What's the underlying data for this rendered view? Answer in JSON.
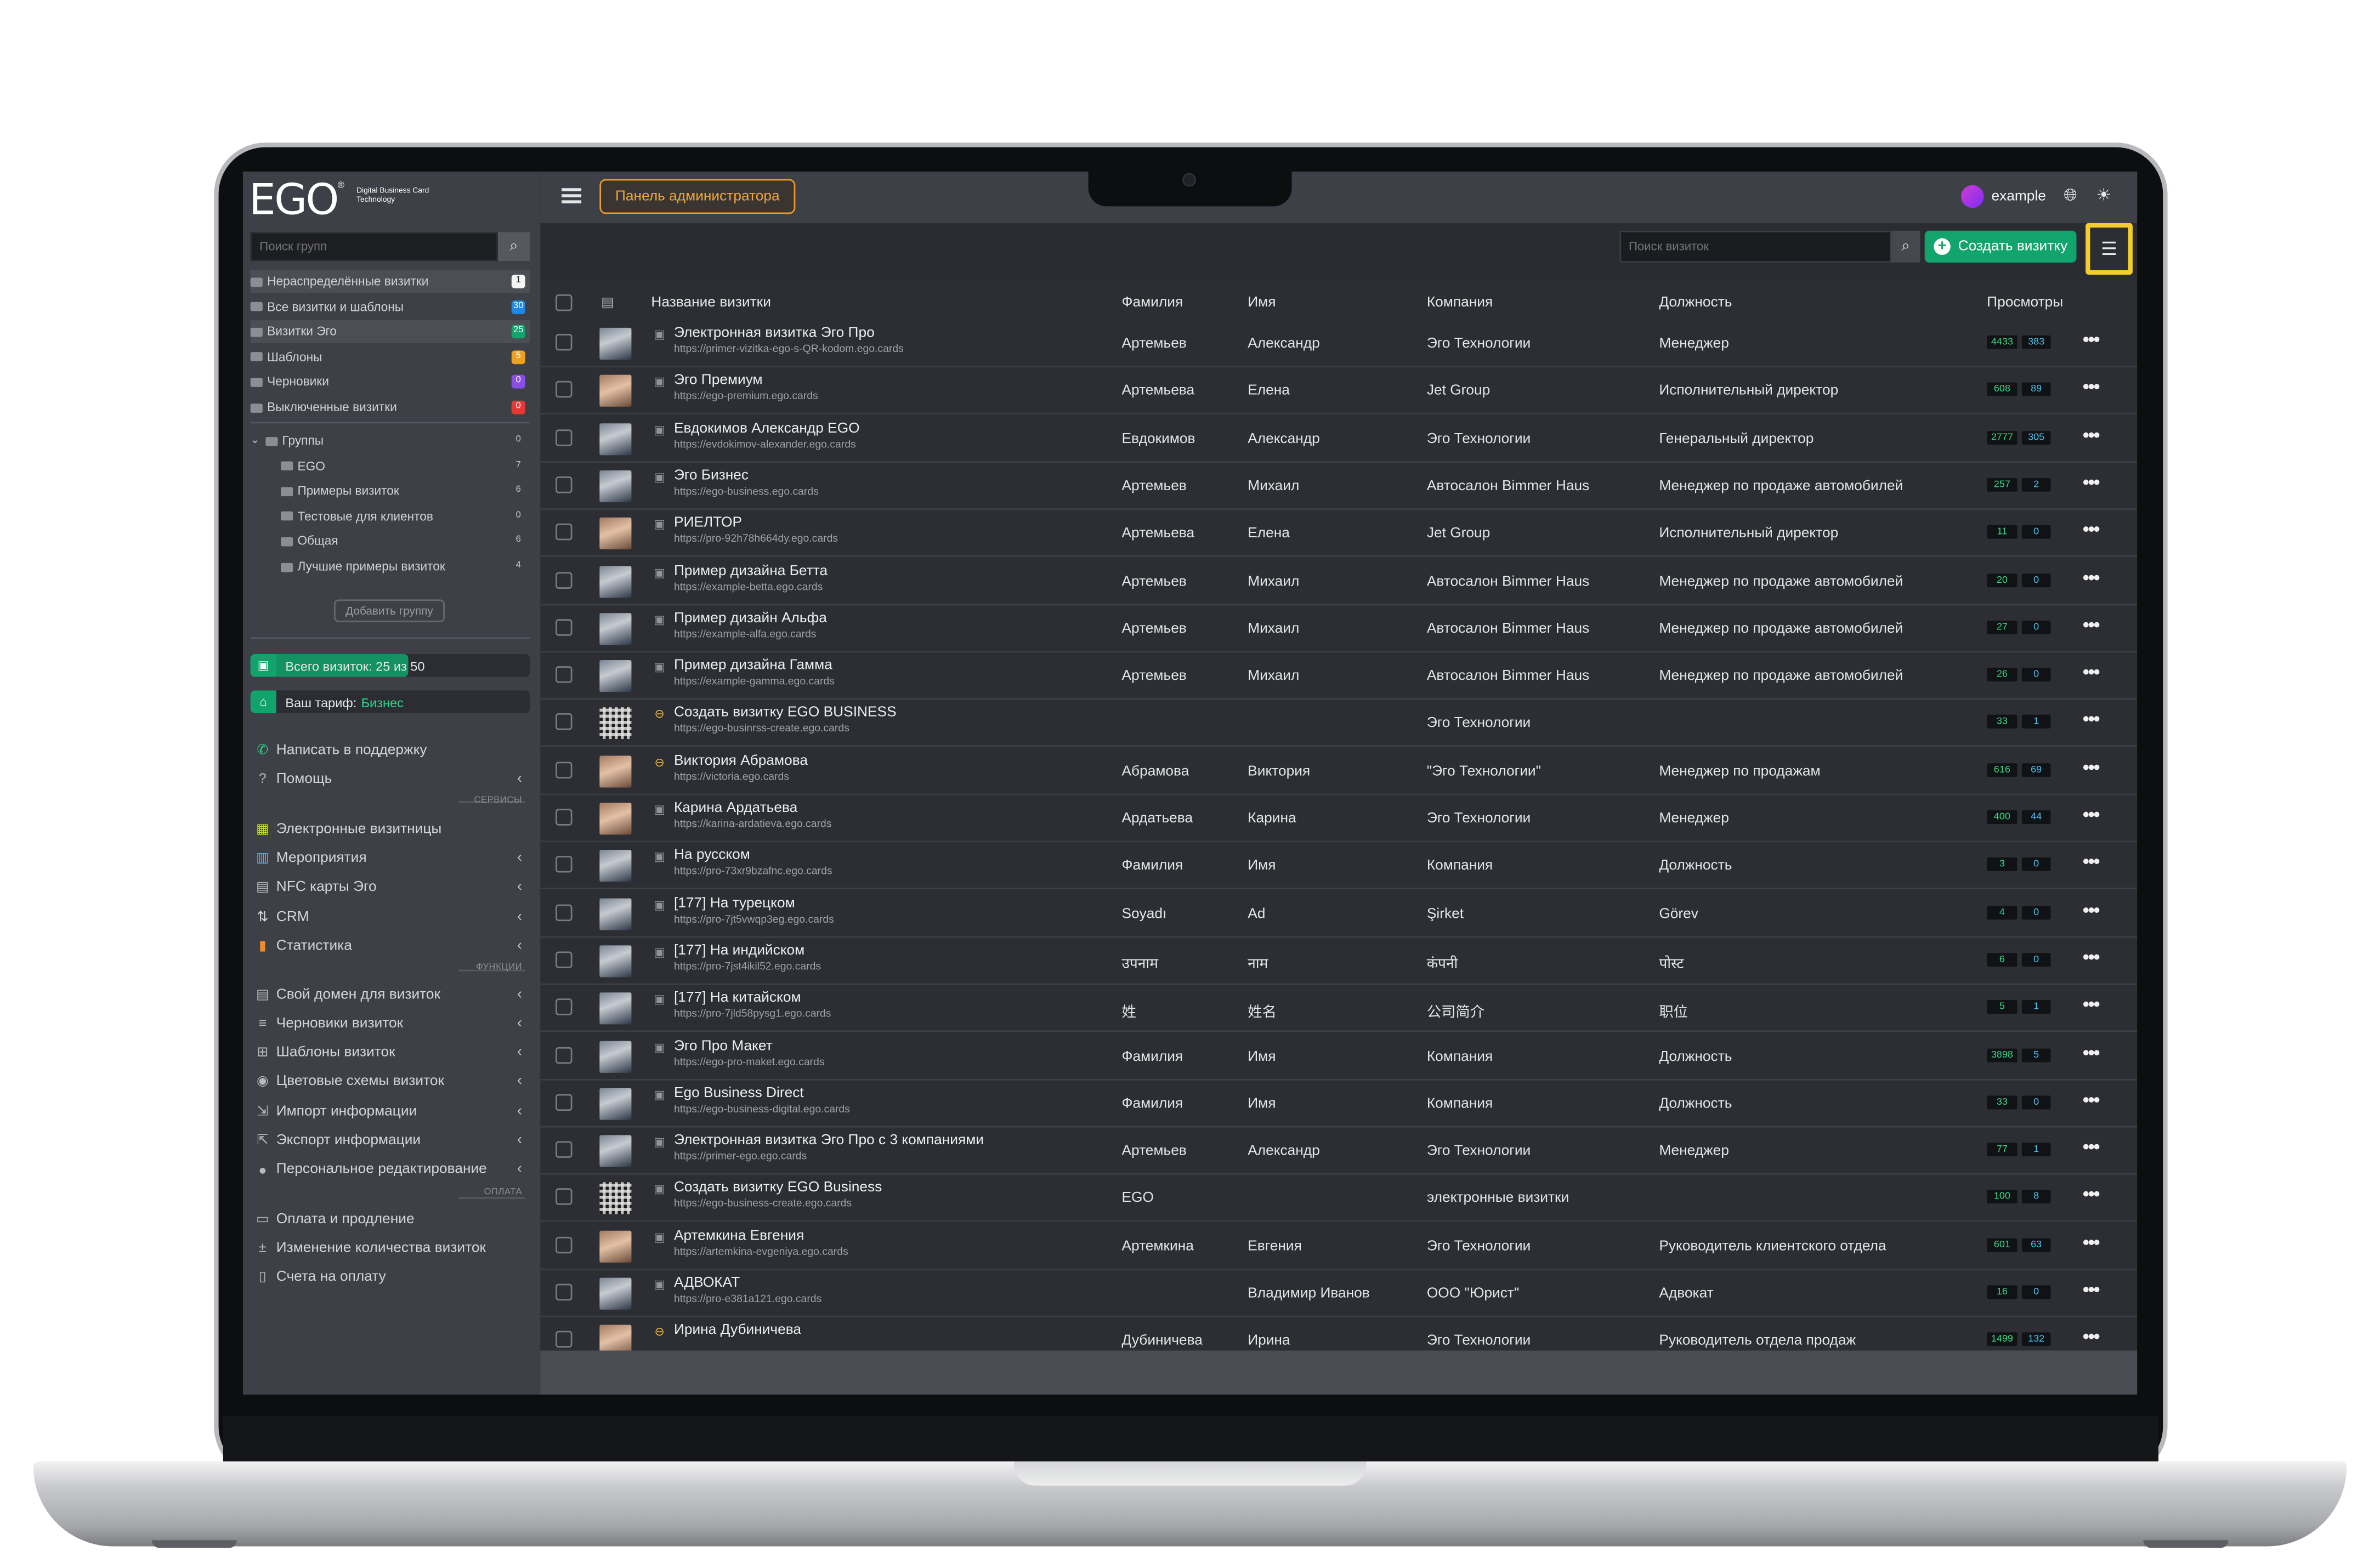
{
  "logo": {
    "text": "EGO",
    "sub": "Digital Business Card Technology"
  },
  "sidebar": {
    "search_placeholder": "Поиск групп",
    "folders": [
      {
        "label": "Нераспределённые визитки",
        "count": "1",
        "color": "#f5f5f5"
      },
      {
        "label": "Все визитки и шаблоны",
        "count": "30",
        "color": "#1e88e5"
      },
      {
        "label": "Визитки Эго",
        "count": "25",
        "color": "#11a36b"
      },
      {
        "label": "Шаблоны",
        "count": "5",
        "color": "#f0a020"
      },
      {
        "label": "Черновики",
        "count": "0",
        "color": "#8a4de6"
      },
      {
        "label": "Выключенные визитки",
        "count": "0",
        "color": "#e53935"
      }
    ],
    "groups": [
      {
        "label": "Группы",
        "count": "0"
      },
      {
        "label": "EGO",
        "count": "7"
      },
      {
        "label": "Примеры визиток",
        "count": "6"
      },
      {
        "label": "Тестовые для клиентов",
        "count": "0"
      },
      {
        "label": "Общая",
        "count": "6"
      },
      {
        "label": "Лучшие примеры визиток",
        "count": "4"
      }
    ],
    "add_group": "Добавить группу",
    "total_label": "Всего визиток: 25 из 50",
    "total_fraction": 0.5,
    "tariff_label": "Ваш тариф:",
    "tariff_value": "Бизнес",
    "support": "Написать в поддержку",
    "help": "Помощь",
    "section_services": "СЕРВИСЫ",
    "services": [
      "Электронные визитницы",
      "Мероприятия",
      "NFC карты Эго",
      "CRM",
      "Статистика"
    ],
    "section_functions": "ФУНКЦИИ",
    "functions": [
      "Свой домен для визиток",
      "Черновики визиток",
      "Шаблоны визиток",
      "Цветовые схемы визиток",
      "Импорт информации",
      "Экспорт информации",
      "Персональное редактирование"
    ],
    "section_payment": "ОПЛАТА",
    "payment": [
      "Оплата и продление",
      "Изменение количества визиток",
      "Счета на оплату"
    ]
  },
  "topbar": {
    "admin_button": "Панель администратора",
    "username": "example"
  },
  "toolbar": {
    "search_placeholder": "Поиск визиток",
    "create_button": "Создать визитку"
  },
  "table": {
    "columns": [
      "Название визитки",
      "Фамилия",
      "Имя",
      "Компания",
      "Должность",
      "Просмотры"
    ],
    "rows": [
      {
        "name": "Электронная визитка Эго Про",
        "url": "https://primer-vizitka-ego-s-QR-kodom.ego.cards",
        "surname": "Артемьев",
        "first": "Александр",
        "company": "Эго Технологии",
        "position": "Менеджер",
        "v1": "4433",
        "v2": "383",
        "kind": "card",
        "thumb": "person"
      },
      {
        "name": "Эго Премиум",
        "url": "https://ego-premium.ego.cards",
        "surname": "Артемьева",
        "first": "Елена",
        "company": "Jet Group",
        "position": "Исполнительный директор",
        "v1": "608",
        "v2": "89",
        "kind": "card",
        "thumb": "warm"
      },
      {
        "name": "Евдокимов Александр EGO",
        "url": "https://evdokimov-alexander.ego.cards",
        "surname": "Евдокимов",
        "first": "Александр",
        "company": "Эго Технологии",
        "position": "Генеральный директор",
        "v1": "2777",
        "v2": "305",
        "kind": "card",
        "thumb": "person"
      },
      {
        "name": "Эго Бизнес",
        "url": "https://ego-business.ego.cards",
        "surname": "Артемьев",
        "first": "Михаил",
        "company": "Автосалон Bimmer Haus",
        "position": "Менеджер по продаже автомобилей",
        "v1": "257",
        "v2": "2",
        "kind": "card",
        "thumb": "person"
      },
      {
        "name": "РИЕЛТОР",
        "url": "https://pro-92h78h664dy.ego.cards",
        "surname": "Артемьева",
        "first": "Елена",
        "company": "Jet Group",
        "position": "Исполнительный директор",
        "v1": "11",
        "v2": "0",
        "kind": "card",
        "thumb": "warm"
      },
      {
        "name": "Пример дизайна Бетта",
        "url": "https://example-betta.ego.cards",
        "surname": "Артемьев",
        "first": "Михаил",
        "company": "Автосалон Bimmer Haus",
        "position": "Менеджер по продаже автомобилей",
        "v1": "20",
        "v2": "0",
        "kind": "card",
        "thumb": "person"
      },
      {
        "name": "Пример дизайн Альфа",
        "url": "https://example-alfa.ego.cards",
        "surname": "Артемьев",
        "first": "Михаил",
        "company": "Автосалон Bimmer Haus",
        "position": "Менеджер по продаже автомобилей",
        "v1": "27",
        "v2": "0",
        "kind": "card",
        "thumb": "person"
      },
      {
        "name": "Пример дизайна Гамма",
        "url": "https://example-gamma.ego.cards",
        "surname": "Артемьев",
        "first": "Михаил",
        "company": "Автосалон Bimmer Haus",
        "position": "Менеджер по продаже автомобилей",
        "v1": "26",
        "v2": "0",
        "kind": "card",
        "thumb": "person"
      },
      {
        "name": "Создать визитку EGO BUSINESS",
        "url": "https://ego-businrss-create.ego.cards",
        "surname": "",
        "first": "",
        "company": "Эго Технологии",
        "position": "",
        "v1": "33",
        "v2": "1",
        "kind": "link",
        "thumb": "qr"
      },
      {
        "name": "Виктория Абрамова",
        "url": "https://victoria.ego.cards",
        "surname": "Абрамова",
        "first": "Виктория",
        "company": "\"Эго Технологии\"",
        "position": "Менеджер по продажам",
        "v1": "616",
        "v2": "69",
        "kind": "link",
        "thumb": "warm"
      },
      {
        "name": "Карина Ардатьева",
        "url": "https://karina-ardatieva.ego.cards",
        "surname": "Ардатьева",
        "first": "Карина",
        "company": "Эго Технологии",
        "position": "Менеджер",
        "v1": "400",
        "v2": "44",
        "kind": "card",
        "thumb": "warm"
      },
      {
        "name": "На русском",
        "url": "https://pro-73xr9bzafnc.ego.cards",
        "surname": "Фамилия",
        "first": "Имя",
        "company": "Компания",
        "position": "Должность",
        "v1": "3",
        "v2": "0",
        "kind": "card",
        "thumb": "person"
      },
      {
        "name": "[177] На турецком",
        "url": "https://pro-7jt5vwqp3eg.ego.cards",
        "surname": "Soyadı",
        "first": "Ad",
        "company": "Şirket",
        "position": "Görev",
        "v1": "4",
        "v2": "0",
        "kind": "card",
        "thumb": "person"
      },
      {
        "name": "[177] На индийском",
        "url": "https://pro-7jst4ikil52.ego.cards",
        "surname": "उपनाम",
        "first": "नाम",
        "company": "कंपनी",
        "position": "पोस्ट",
        "v1": "6",
        "v2": "0",
        "kind": "card",
        "thumb": "person"
      },
      {
        "name": "[177] На китайском",
        "url": "https://pro-7jld58pysg1.ego.cards",
        "surname": "姓",
        "first": "姓名",
        "company": "公司简介",
        "position": "职位",
        "v1": "5",
        "v2": "1",
        "kind": "card",
        "thumb": "person"
      },
      {
        "name": "Эго Про Макет",
        "url": "https://ego-pro-maket.ego.cards",
        "surname": "Фамилия",
        "first": "Имя",
        "company": "Компания",
        "position": "Должность",
        "v1": "3898",
        "v2": "5",
        "kind": "card",
        "thumb": "person"
      },
      {
        "name": "Ego Business Direct",
        "url": "https://ego-business-digital.ego.cards",
        "surname": "Фамилия",
        "first": "Имя",
        "company": "Компания",
        "position": "Должность",
        "v1": "33",
        "v2": "0",
        "kind": "card",
        "thumb": "person"
      },
      {
        "name": "Электронная визитка Эго Про с 3 компаниями",
        "url": "https://primer-ego.ego.cards",
        "surname": "Артемьев",
        "first": "Александр",
        "company": "Эго Технологии",
        "position": "Менеджер",
        "v1": "77",
        "v2": "1",
        "kind": "card",
        "thumb": "person"
      },
      {
        "name": "Создать визитку EGO Business",
        "url": "https://ego-business-create.ego.cards",
        "surname": "EGO",
        "first": "",
        "company": "электронные визитки",
        "position": "",
        "v1": "100",
        "v2": "8",
        "kind": "card",
        "thumb": "qr"
      },
      {
        "name": "Артемкина Евгения",
        "url": "https://artemkina-evgeniya.ego.cards",
        "surname": "Артемкина",
        "first": "Евгения",
        "company": "Эго Технологии",
        "position": "Руководитель клиентского отдела",
        "v1": "601",
        "v2": "63",
        "kind": "card",
        "thumb": "warm"
      },
      {
        "name": "АДВОКАТ",
        "url": "https://pro-e381a121.ego.cards",
        "surname": "",
        "first": "Владимир Иванов",
        "company": "ООО \"Юрист\"",
        "position": "Адвокат",
        "v1": "16",
        "v2": "0",
        "kind": "card",
        "thumb": "person"
      },
      {
        "name": "Ирина Дубиничева",
        "url": "",
        "surname": "Дубиничева",
        "first": "Ирина",
        "company": "Эго Технологии",
        "position": "Руководитель отдела продаж",
        "v1": "1499",
        "v2": "132",
        "kind": "link",
        "thumb": "warm"
      }
    ]
  },
  "colors": {
    "accent": "#12a46d",
    "admin": "#f0a535",
    "highlight": "#f3ce2e"
  }
}
